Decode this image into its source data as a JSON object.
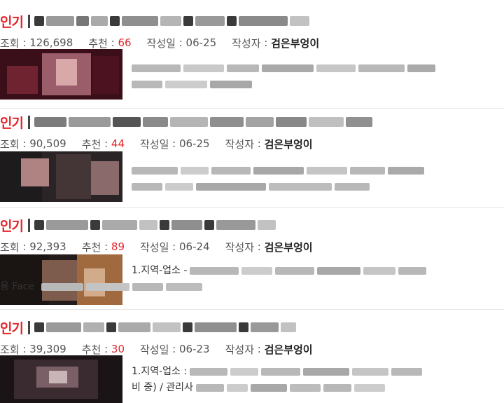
{
  "posts": [
    {
      "badge": "인기",
      "meta": {
        "views_label": "조회",
        "views": "126,698",
        "likes_label": "추천",
        "likes": "66",
        "date_label": "작성일",
        "date": "06-25",
        "author_label": "작성자",
        "author": "검은부엉이"
      },
      "excerpt_lines": [
        "",
        ""
      ]
    },
    {
      "badge": "인기",
      "meta": {
        "views_label": "조회",
        "views": "90,509",
        "likes_label": "추천",
        "likes": "44",
        "date_label": "작성일",
        "date": "06-25",
        "author_label": "작성자",
        "author": "검은부엉이"
      },
      "excerpt_lines": [
        "",
        ""
      ]
    },
    {
      "badge": "인기",
      "meta": {
        "views_label": "조회",
        "views": "92,393",
        "likes_label": "추천",
        "likes": "89",
        "date_label": "작성일",
        "date": "06-24",
        "author_label": "작성자",
        "author": "검은부엉이"
      },
      "excerpt_lines": [
        "1.지역-업소 -",
        "용   Face"
      ]
    },
    {
      "badge": "인기",
      "meta": {
        "views_label": "조회",
        "views": "39,309",
        "likes_label": "추천",
        "likes": "30",
        "date_label": "작성일",
        "date": "06-23",
        "author_label": "작성자",
        "author": "검은부엉이"
      },
      "excerpt_lines": [
        "1.지역-업소 :",
        "비 중) / 관리사"
      ]
    }
  ],
  "colors": {
    "hot": "#e3262b",
    "likes": "#e3262b"
  }
}
